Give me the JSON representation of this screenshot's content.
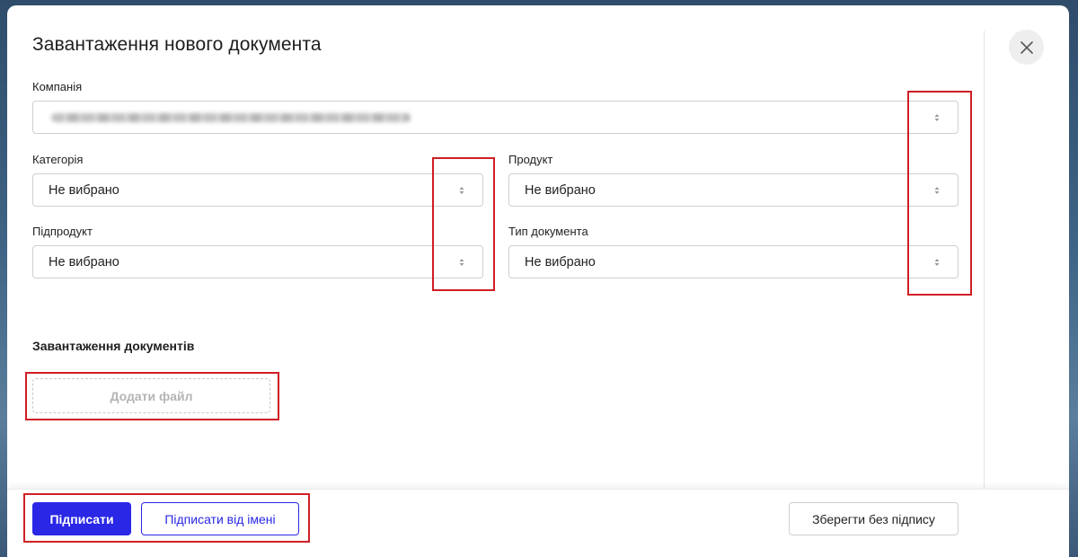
{
  "dialog": {
    "title": "Завантаження нового документа",
    "close_icon": "close-icon"
  },
  "form": {
    "company": {
      "label": "Компанія",
      "value": ""
    },
    "category": {
      "label": "Категорія",
      "value": "Не вибрано"
    },
    "product": {
      "label": "Продукт",
      "value": "Не вибрано"
    },
    "subproduct": {
      "label": "Підпродукт",
      "value": "Не вибрано"
    },
    "doc_type": {
      "label": "Тип документа",
      "value": "Не вибрано"
    }
  },
  "upload": {
    "section_title": "Завантаження документів",
    "add_file_label": "Додати файл"
  },
  "footer": {
    "sign_label": "Підписати",
    "sign_on_behalf_label": "Підписати від імені",
    "save_unsigned_label": "Зберегти без підпису"
  },
  "colors": {
    "primary": "#2a27e6",
    "highlight": "#d01e25"
  }
}
